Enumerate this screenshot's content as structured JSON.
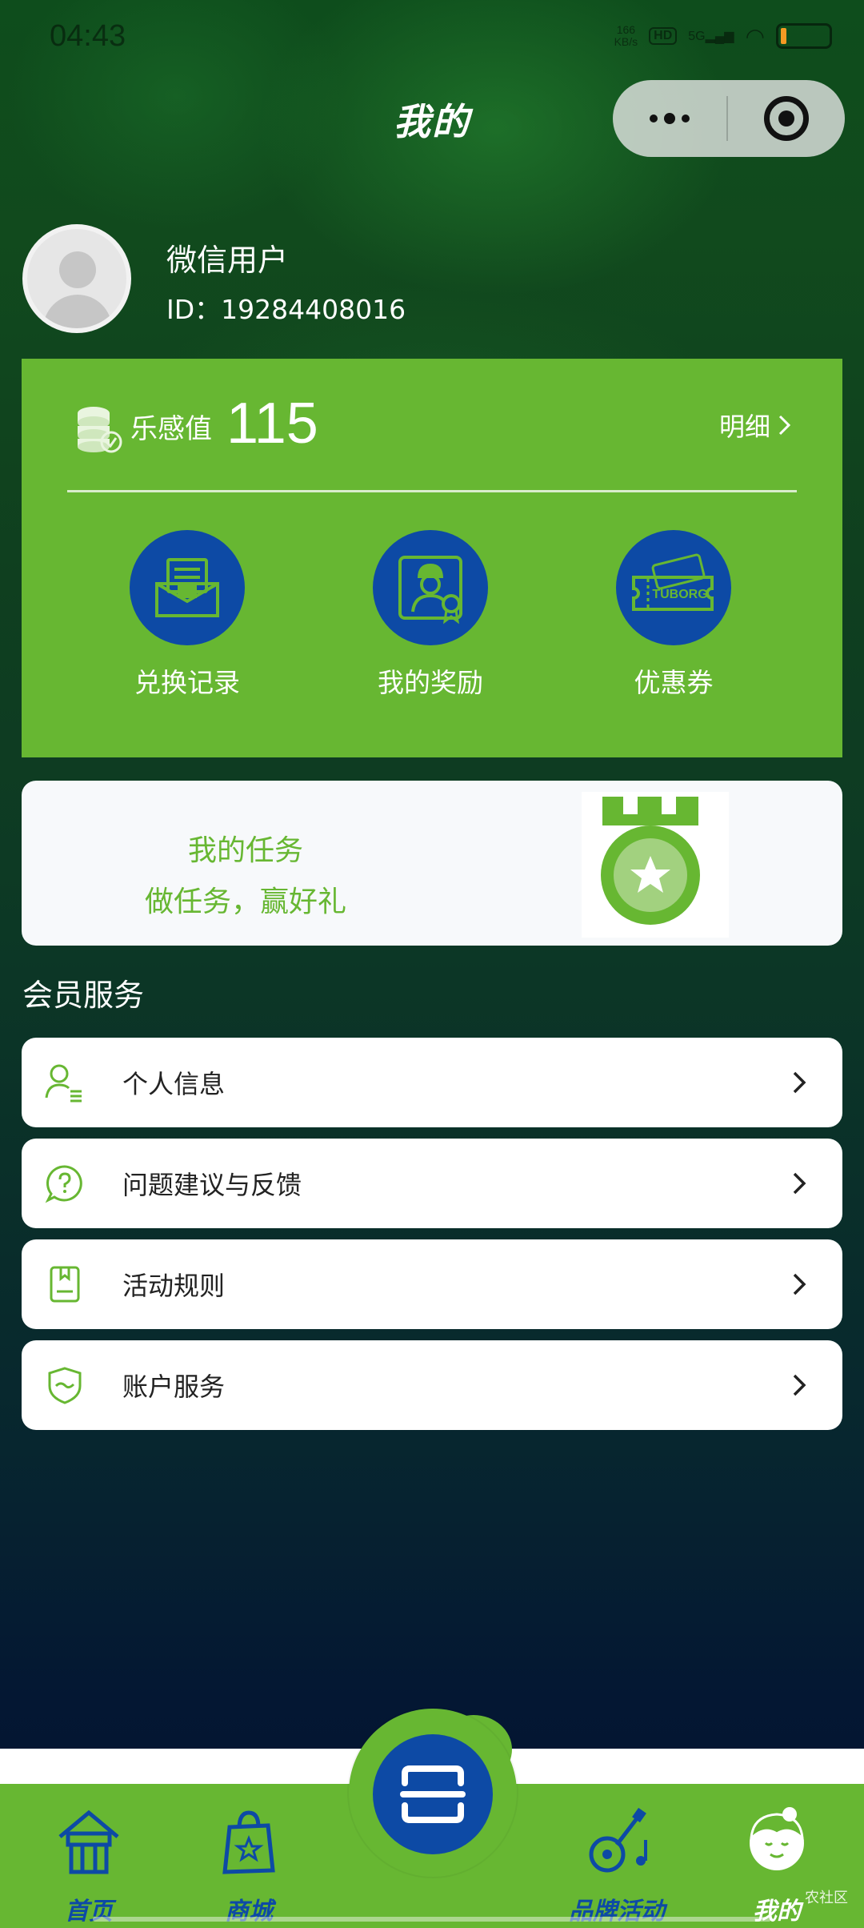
{
  "status_bar": {
    "time": "04:43",
    "net_speed_value": "166",
    "net_speed_unit": "KB/s",
    "hd": "HD",
    "signal": "5G",
    "battery_level": 0.12
  },
  "header": {
    "title": "我的"
  },
  "user": {
    "name": "微信用户",
    "id": "ID：19284408016"
  },
  "points": {
    "label": "乐感值",
    "value": "115",
    "detail_label": "明细"
  },
  "features": [
    {
      "label": "兑换记录",
      "icon": "envelope-icon"
    },
    {
      "label": "我的奖励",
      "icon": "reward-icon"
    },
    {
      "label": "优惠券",
      "icon": "ticket-icon"
    }
  ],
  "ticket_brand": "TUBORG",
  "task": {
    "title": "我的任务",
    "subtitle": "做任务，赢好礼"
  },
  "member_services": {
    "title": "会员服务",
    "items": [
      {
        "label": "个人信息",
        "icon": "user-info-icon"
      },
      {
        "label": "问题建议与反馈",
        "icon": "question-icon"
      },
      {
        "label": "活动规则",
        "icon": "rules-icon"
      },
      {
        "label": "账户服务",
        "icon": "shield-icon"
      }
    ]
  },
  "tabbar": {
    "items": [
      {
        "label": "首页",
        "icon": "home-icon",
        "active": false
      },
      {
        "label": "商城",
        "icon": "shop-bag-icon",
        "active": false
      },
      {
        "label": "品牌活动",
        "icon": "guitar-icon",
        "active": false
      },
      {
        "label": "我的",
        "icon": "profile-icon",
        "active": true
      }
    ],
    "center_icon": "scan-icon"
  },
  "watermark": "农社区",
  "colors": {
    "card_green": "#67b732",
    "brand_blue": "#0d4aa5",
    "white": "#ffffff"
  }
}
